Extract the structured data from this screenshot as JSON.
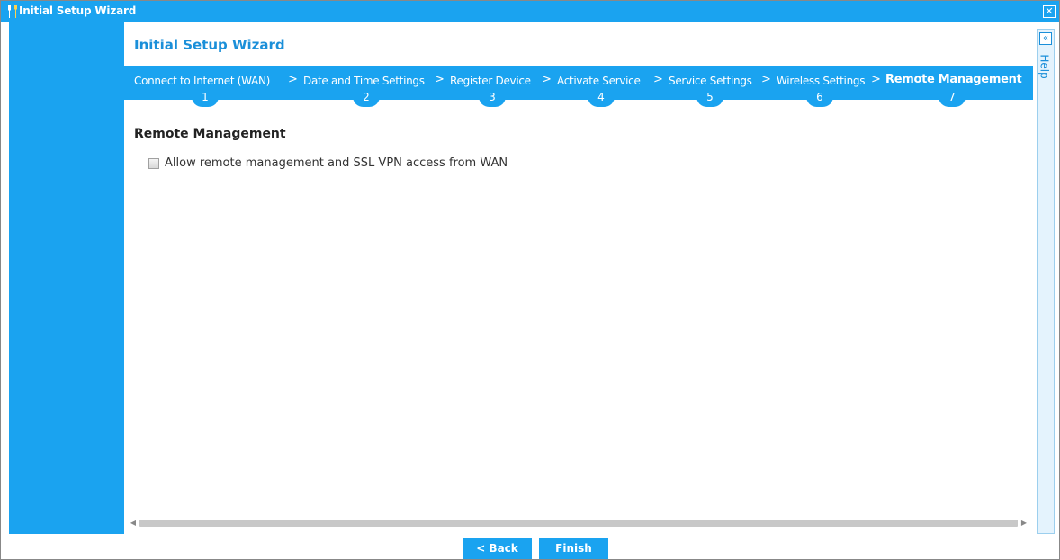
{
  "window": {
    "title": "Initial Setup Wizard",
    "close_glyph": "✕"
  },
  "wizard": {
    "heading": "Initial Setup Wizard",
    "steps": [
      {
        "label": "Connect to Internet (WAN)",
        "number": "1"
      },
      {
        "label": "Date and Time Settings",
        "number": "2"
      },
      {
        "label": "Register Device",
        "number": "3"
      },
      {
        "label": "Activate Service",
        "number": "4"
      },
      {
        "label": "Service Settings",
        "number": "5"
      },
      {
        "label": "Wireless Settings",
        "number": "6"
      },
      {
        "label": "Remote Management",
        "number": "7"
      }
    ],
    "active_step": 7,
    "separator": ">"
  },
  "section": {
    "title": "Remote Management",
    "option_label": "Allow remote management and SSL VPN access from WAN",
    "option_checked": false
  },
  "scroll": {
    "left_arrow": "◀",
    "right_arrow": "▶"
  },
  "help": {
    "collapse_glyph": "«",
    "label": "Help"
  },
  "buttons": {
    "back": "< Back",
    "finish": "Finish"
  },
  "colors": {
    "accent": "#1aa3f0",
    "title_text": "#1a8fd9"
  }
}
